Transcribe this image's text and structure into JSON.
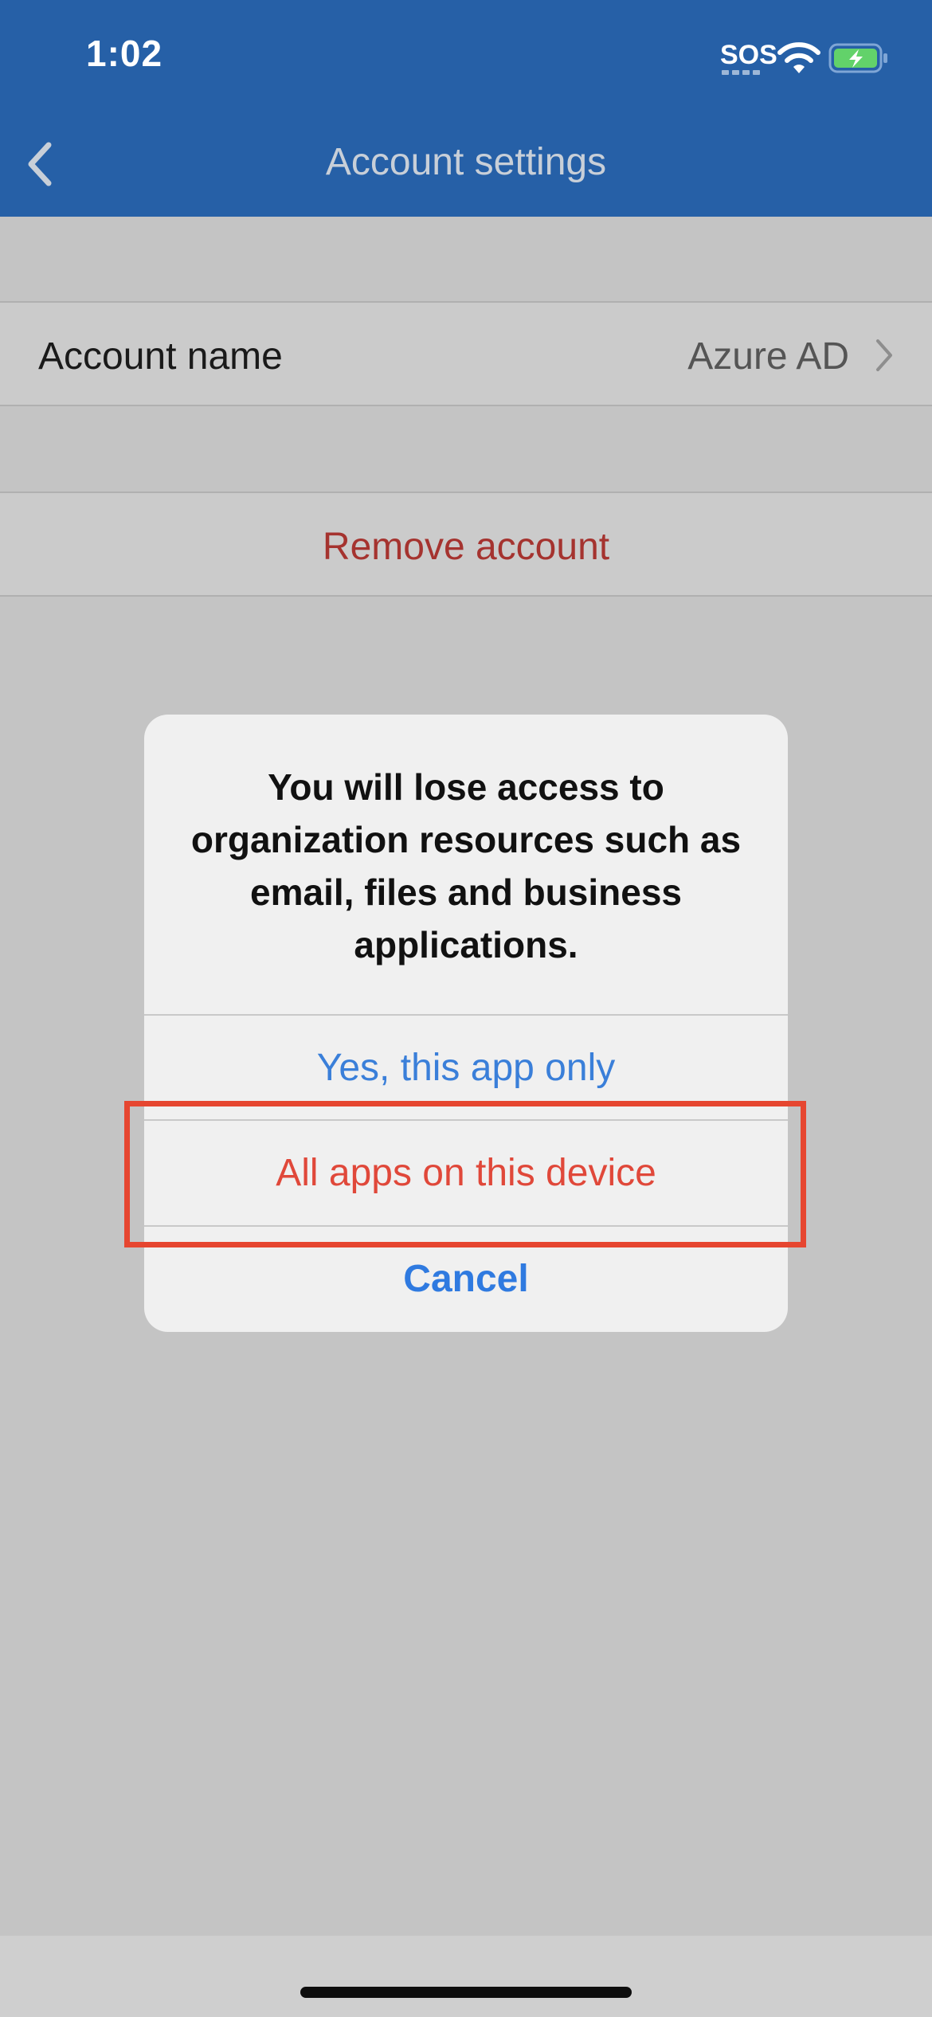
{
  "status_bar": {
    "time": "1:02",
    "sos": "SOS",
    "icons": [
      "wifi-icon",
      "battery-charging-icon"
    ]
  },
  "nav": {
    "title": "Account settings",
    "back_icon": "chevron-left-icon"
  },
  "settings": {
    "account_name_label": "Account name",
    "account_name_value": "Azure AD",
    "remove_account_label": "Remove account"
  },
  "alert": {
    "message": "You will lose access to organization resources such as email, files and business applications.",
    "buttons": {
      "yes_this_app_only": "Yes, this app only",
      "all_apps_on_device": "All apps on this device",
      "cancel": "Cancel"
    }
  },
  "colors": {
    "header_bg": "#2660a7",
    "destructive": "#e0483a",
    "action_blue": "#3a7fd9",
    "highlight": "#e64630",
    "overlay_bg": "#c4c4c4"
  }
}
